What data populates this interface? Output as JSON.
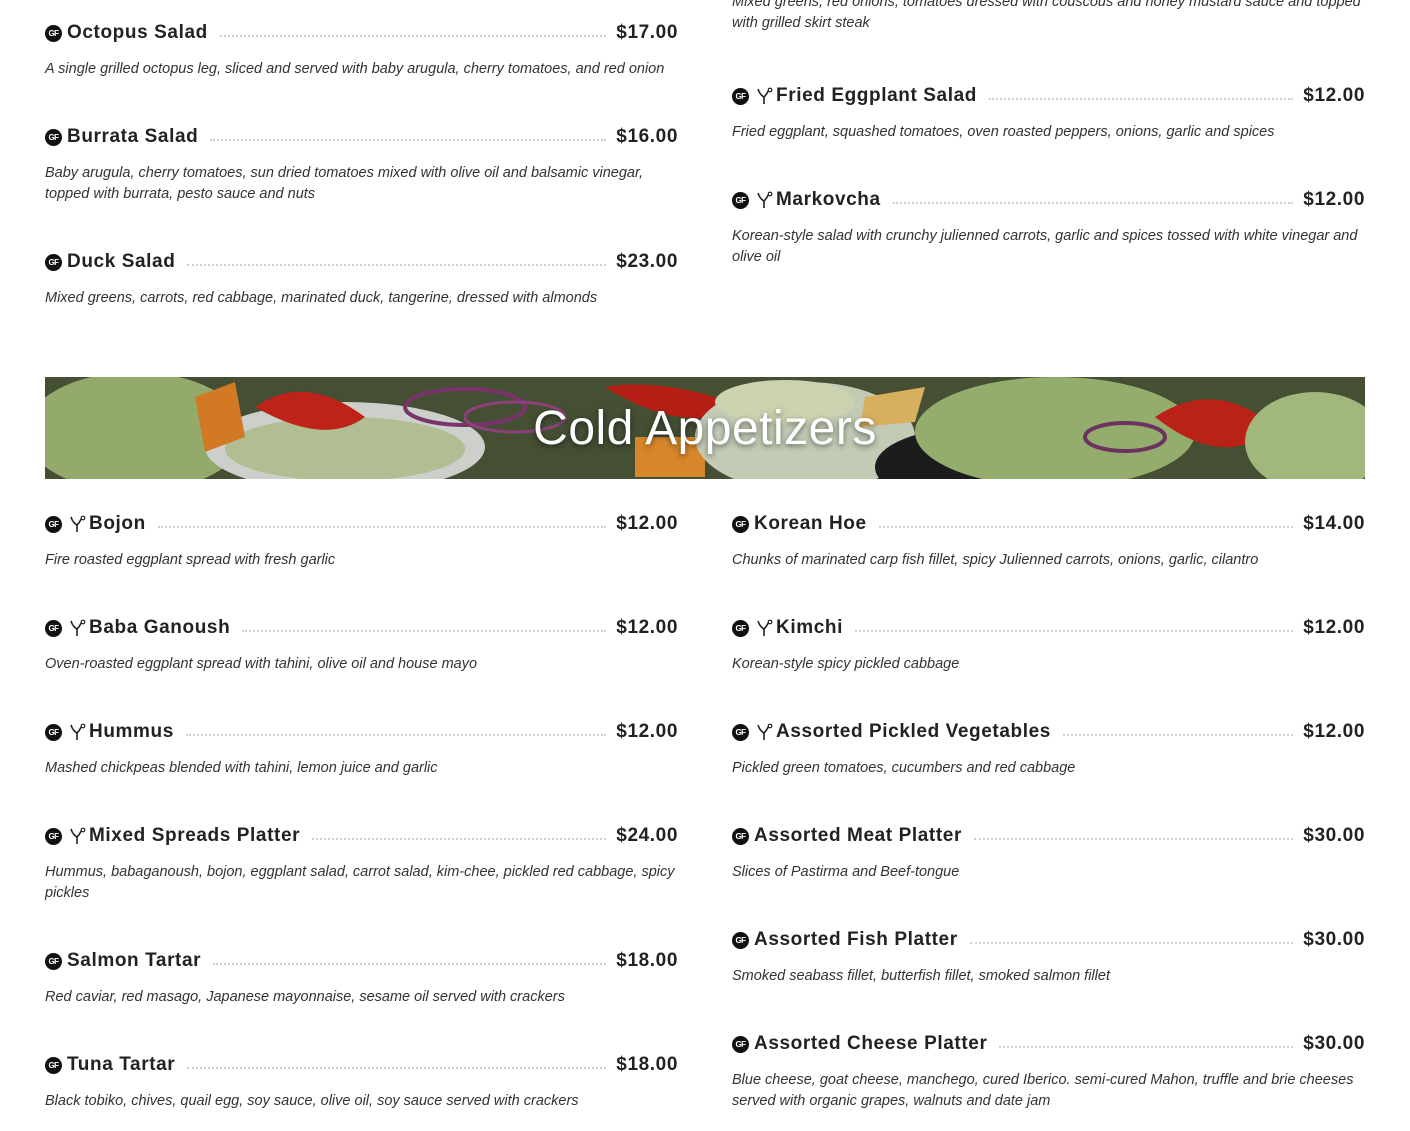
{
  "salads_left": [
    {
      "name": "Octopus Salad",
      "price": "$17.00",
      "gf": true,
      "veg": false,
      "desc": "A single grilled octopus leg, sliced and served with baby arugula, cherry tomatoes, and red onion"
    },
    {
      "name": "Burrata Salad",
      "price": "$16.00",
      "gf": true,
      "veg": false,
      "desc": "Baby arugula, cherry tomatoes, sun dried tomatoes mixed with olive oil and balsamic vinegar, topped with burrata, pesto sauce and nuts"
    },
    {
      "name": "Duck Salad",
      "price": "$23.00",
      "gf": true,
      "veg": false,
      "desc": "Mixed greens, carrots, red cabbage, marinated duck, tangerine, dressed with almonds"
    }
  ],
  "salads_right_partial_desc": "Mixed greens, red onions, tomatoes dressed with couscous and honey mustard sauce and topped with grilled skirt steak",
  "salads_right": [
    {
      "name": "Fried Eggplant Salad",
      "price": "$12.00",
      "gf": true,
      "veg": true,
      "desc": "Fried eggplant, squashed tomatoes, oven roasted peppers, onions, garlic and spices"
    },
    {
      "name": "Markovcha",
      "price": "$12.00",
      "gf": true,
      "veg": true,
      "desc": "Korean-style salad with crunchy julienned carrots, garlic and spices tossed with white vinegar and olive oil"
    }
  ],
  "banner": {
    "title": "Cold Appetizers"
  },
  "cold_left": [
    {
      "name": "Bojon",
      "price": "$12.00",
      "gf": true,
      "veg": true,
      "desc": "Fire roasted eggplant spread with fresh garlic"
    },
    {
      "name": "Baba Ganoush",
      "price": "$12.00",
      "gf": true,
      "veg": true,
      "desc": "Oven-roasted eggplant spread with tahini, olive oil and house mayo"
    },
    {
      "name": "Hummus",
      "price": "$12.00",
      "gf": true,
      "veg": true,
      "desc": "Mashed chickpeas blended with tahini, lemon juice and garlic"
    },
    {
      "name": "Mixed Spreads Platter",
      "price": "$24.00",
      "gf": true,
      "veg": true,
      "desc": "Hummus, babaganoush, bojon, eggplant salad, carrot salad, kim-chee, pickled red cabbage, spicy pickles"
    },
    {
      "name": "Salmon Tartar",
      "price": "$18.00",
      "gf": true,
      "veg": false,
      "desc": "Red caviar, red masago, Japanese mayonnaise, sesame oil served with crackers"
    },
    {
      "name": "Tuna Tartar",
      "price": "$18.00",
      "gf": true,
      "veg": false,
      "desc": "Black tobiko, chives, quail egg, soy sauce, olive oil, soy sauce served with crackers"
    }
  ],
  "cold_right": [
    {
      "name": "Korean Hoe",
      "price": "$14.00",
      "gf": true,
      "veg": false,
      "desc": "Chunks of marinated carp fish fillet, spicy Julienned carrots, onions, garlic, cilantro"
    },
    {
      "name": "Kimchi",
      "price": "$12.00",
      "gf": true,
      "veg": true,
      "desc": "Korean-style spicy pickled cabbage"
    },
    {
      "name": "Assorted Pickled Vegetables",
      "price": "$12.00",
      "gf": true,
      "veg": true,
      "desc": "Pickled green tomatoes, cucumbers and red cabbage"
    },
    {
      "name": "Assorted Meat Platter",
      "price": "$30.00",
      "gf": true,
      "veg": false,
      "desc": "Slices of Pastirma and Beef-tongue"
    },
    {
      "name": "Assorted Fish Platter",
      "price": "$30.00",
      "gf": true,
      "veg": false,
      "desc": "Smoked seabass fillet, butterfish fillet, smoked salmon fillet"
    },
    {
      "name": "Assorted Cheese Platter",
      "price": "$30.00",
      "gf": true,
      "veg": false,
      "desc": "Blue cheese, goat cheese, manchego, cured Iberico. semi-cured Mahon, truffle and brie cheeses served with organic grapes, walnuts and date jam"
    }
  ],
  "icons": {
    "gf_label": "GF",
    "gf_name": "gluten-free-icon",
    "veg_name": "vegan-sprout-icon"
  }
}
